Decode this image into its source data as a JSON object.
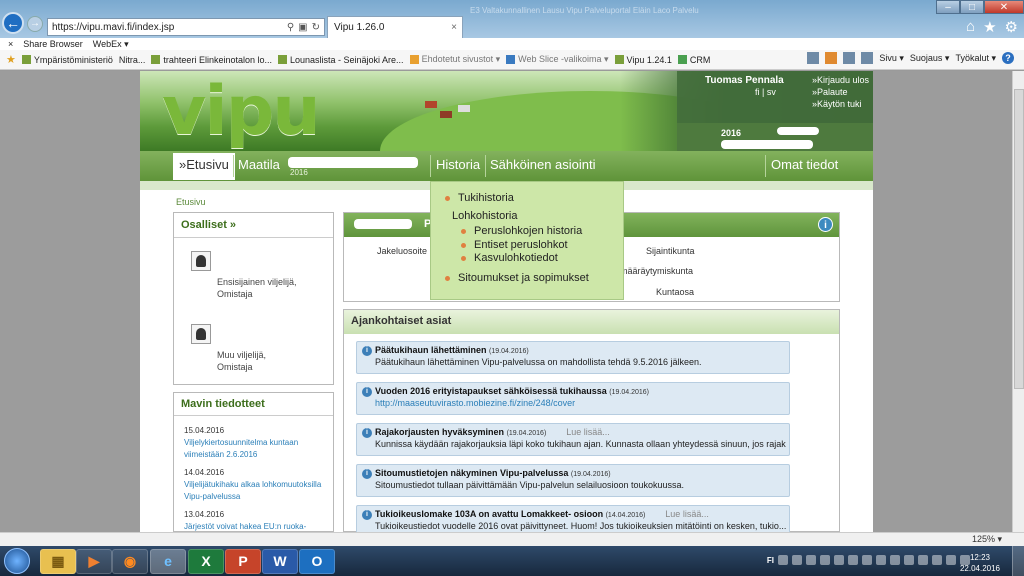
{
  "browser": {
    "address": "https://vipu.mavi.fi/index.jsp",
    "tab_title": "Vipu 1.26.0",
    "tab_close": "×",
    "faded_tabs": "E3 Valtakunnallinen Lausu  Vipu Palveluportal  Eläin Laco  Palvelu",
    "back_icon": "←",
    "forward_icon": "→",
    "right_icons": [
      "⌂",
      "★",
      "⚙"
    ],
    "bar1": {
      "close": "×",
      "share": "Share Browser",
      "webex": "WebEx ▾"
    },
    "favorites": [
      {
        "label": "Ympäristöministeriö",
        "grey": false
      },
      {
        "label": "Nitra...",
        "grey": false
      },
      {
        "label": "trahteeri Elinkeinotalon lo...",
        "grey": false
      },
      {
        "label": "Lounaslista - Seinäjoki Are...",
        "grey": false
      },
      {
        "label": "Ehdotetut sivustot ▾",
        "grey": true
      },
      {
        "label": "Web Slice -valikoima ▾",
        "grey": true
      },
      {
        "label": "Vipu 1.24.1",
        "grey": false
      },
      {
        "label": "CRM",
        "grey": false
      }
    ],
    "commands": {
      "sivu": "Sivu ▾",
      "suojaus": "Suojaus ▾",
      "tyokalut": "Työkalut ▾",
      "help": "?"
    },
    "zoom": "125% ▾",
    "win_controls": [
      "–",
      "□",
      "✕"
    ]
  },
  "header": {
    "logo": "vipu",
    "user_name": "Tuomas Pennala",
    "lang": "fi | sv",
    "links": [
      "»Kirjaudu ulos",
      "»Palaute",
      "»Käytön tuki"
    ],
    "year": "2016"
  },
  "nav": {
    "etusivu": "»Etusivu",
    "maatila": "Maatila",
    "maatila_year": "2016",
    "historia": "Historia",
    "sahkoinen": "Sähköinen asiointi",
    "omat": "Omat tiedot"
  },
  "dropdown": {
    "tukihistoria": "Tukihistoria",
    "lohkohistoria": "Lohkohistoria",
    "sub": [
      "Peruslohkojen historia",
      "Entiset peruslohkot",
      "Kasvulohkotiedot"
    ],
    "sitoumukset": "Sitoumukset ja sopimukset"
  },
  "breadcrumb": "Etusivu",
  "osalliset": {
    "title": "Osalliset »",
    "people": [
      {
        "role": "Ensisijainen viljelijä,",
        "role2": "Omistaja"
      },
      {
        "role": "Muu viljelijä,",
        "role2": "Omistaja"
      }
    ]
  },
  "mavin": {
    "title": "Mavin tiedotteet",
    "items": [
      {
        "date": "15.04.2016",
        "title": "Viljelykiertosuunnitelma kuntaan viimeistään 2.6.2016"
      },
      {
        "date": "14.04.2016",
        "title": "Viljelijätukihaku alkaa lohkomuutoksilla Vipu-palvelussa"
      },
      {
        "date": "13.04.2016",
        "title": "Järjestöt voivat hakea EU:n ruoka-"
      }
    ]
  },
  "info_panel": {
    "head_letter": "P",
    "labels": {
      "jakeluosoite": "Jakeluosoite",
      "sijaintikunta": "Sijaintikunta",
      "maaraytymiskunta": "määräytymiskunta",
      "kuntaosa": "Kuntaosa"
    },
    "info_icon": "i"
  },
  "ajankohtaiset": {
    "title": "Ajankohtaiset asiat",
    "items": [
      {
        "title": "Päätukihaun lähettäminen",
        "date": "(19.04.2016)",
        "more": "",
        "body": "Päätukihaun lähettäminen Vipu-palvelussa on mahdollista tehdä 9.5.2016 jälkeen.",
        "link": false
      },
      {
        "title": "Vuoden 2016 erityistapaukset sähköisessä tukihaussa",
        "date": "(19.04.2016)",
        "more": "",
        "body": "http://maaseutuvirasto.mobiezine.fi/zine/248/cover",
        "link": true
      },
      {
        "title": "Rajakorjausten hyväksyminen",
        "date": "(19.04.2016)",
        "more": "Lue lisää...",
        "body": "Kunnissa käydään rajakorjauksia läpi koko tukihaun ajan. Kunnasta ollaan yhteydessä sinuun, jos rajak",
        "link": false
      },
      {
        "title": "Sitoumustietojen näkyminen Vipu-palvelussa",
        "date": "(19.04.2016)",
        "more": "",
        "body": "Sitoumustiedot tullaan päivittämään Vipu-palvelun selailuosioon toukokuussa.",
        "link": false
      },
      {
        "title": "Tukioikeuslomake 103A on avattu Lomakkeet- osioon",
        "date": "(14.04.2016)",
        "more": "Lue lisää...",
        "body": "Tukioikeustiedot vuodelle 2016 ovat päivittyneet. Huom! Jos tukioikeuksien mitätöinti on kesken, tukio...",
        "link": false
      }
    ]
  },
  "taskbar": {
    "apps": [
      "▦",
      "▶",
      "◉",
      "e",
      "X",
      "P",
      "W",
      "O"
    ],
    "lang": "FI",
    "time": "12:23",
    "date": "22.04.2016"
  },
  "colors": {
    "brand_green": "#6aa043",
    "logo_green": "#7ab83a",
    "dropdown_bg": "#cde7a8",
    "notice_bg": "#dde9f3"
  }
}
